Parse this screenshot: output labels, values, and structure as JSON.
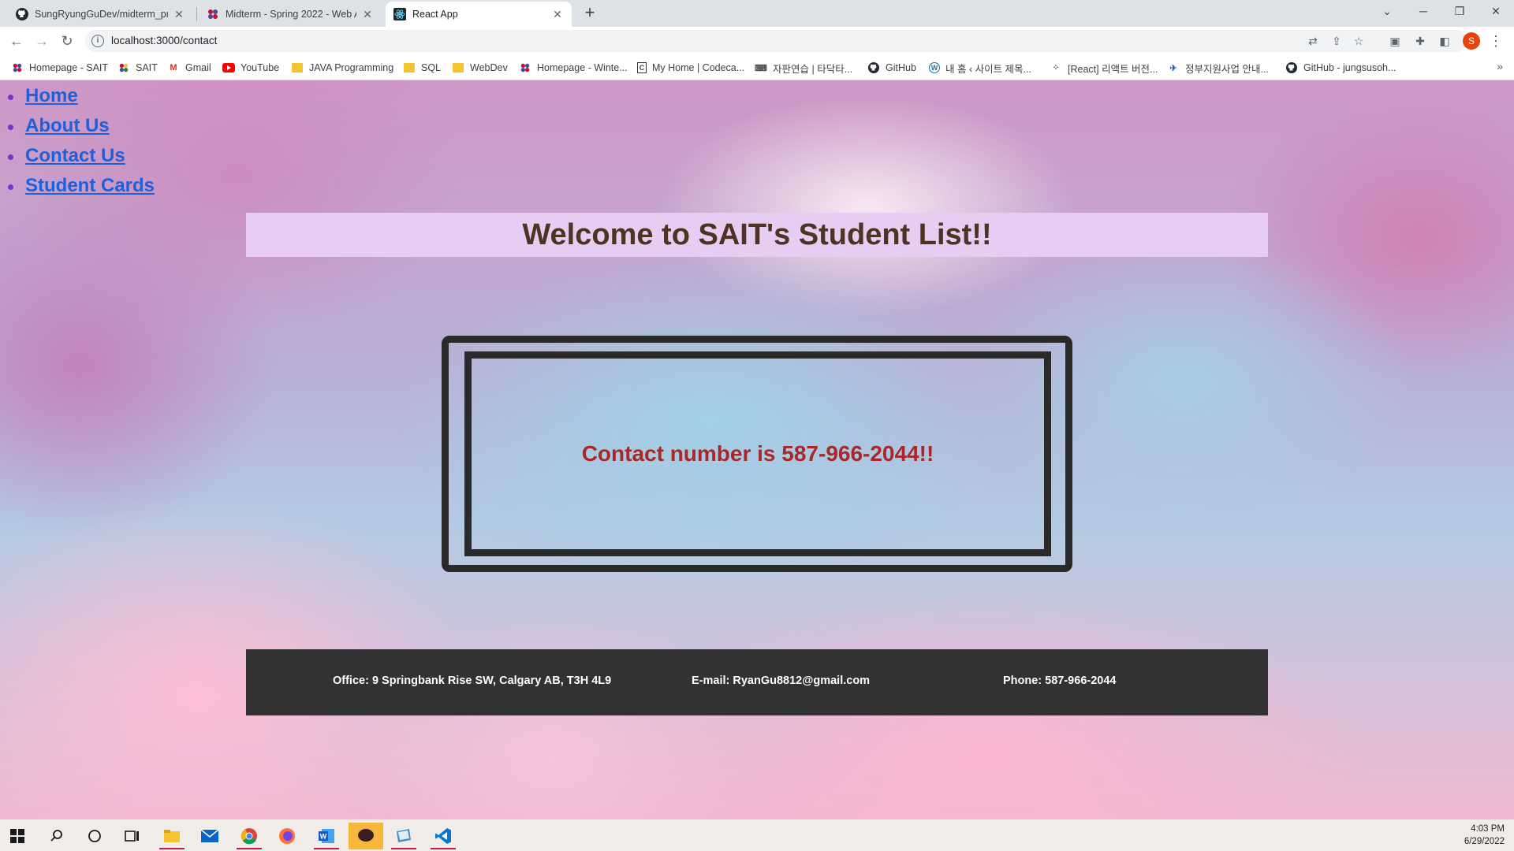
{
  "browser": {
    "tabs": [
      {
        "title": "SungRyungGuDev/midterm_proj",
        "icon": "github-icon"
      },
      {
        "title": "Midterm - Spring 2022 - Web Ap",
        "icon": "sait-icon"
      },
      {
        "title": "React App",
        "icon": "react-icon"
      }
    ],
    "new_tab": "+",
    "address": "localhost:3000/contact",
    "profile_initial": "S"
  },
  "bookmarks": [
    {
      "label": "Homepage - SAIT",
      "icon": "sait-icon"
    },
    {
      "label": "SAIT",
      "icon": "sait-icon"
    },
    {
      "label": "Gmail",
      "icon": "gmail-icon"
    },
    {
      "label": "YouTube",
      "icon": "youtube-icon"
    },
    {
      "label": "JAVA Programming",
      "icon": "folder-icon"
    },
    {
      "label": "SQL",
      "icon": "folder-icon"
    },
    {
      "label": "WebDev",
      "icon": "folder-icon"
    },
    {
      "label": "Homepage - Winte...",
      "icon": "sait-icon"
    },
    {
      "label": "My Home | Codeca...",
      "icon": "codecademy-icon"
    },
    {
      "label": "자판연습 | 타닥타...",
      "icon": "keyboard-icon"
    },
    {
      "label": "GitHub",
      "icon": "github-icon"
    },
    {
      "label": "내 홈 ‹ 사이트 제목...",
      "icon": "wordpress-icon"
    },
    {
      "label": "[React] 리액트 버전...",
      "icon": "dots-icon"
    },
    {
      "label": "정부지원사업 안내...",
      "icon": "gov-icon"
    },
    {
      "label": "GitHub - jungsusoh...",
      "icon": "github-icon"
    }
  ],
  "page": {
    "nav": [
      "Home",
      "About Us",
      "Contact Us",
      "Student Cards"
    ],
    "title": "Welcome to SAIT's Student List!!",
    "contact": "Contact number is 587-966-2044!!",
    "footer": {
      "office": "Office: 9 Springbank Rise SW, Calgary AB, T3H 4L9",
      "email": "E-mail: RyanGu8812@gmail.com",
      "phone": "Phone: 587-966-2044"
    }
  },
  "taskbar": {
    "time": "4:03 PM",
    "date": "6/29/2022"
  },
  "colors": {
    "nav_link": "#1f5fd8",
    "banner_bg": "#e6cdf1",
    "title_text": "#4e3322",
    "contact_text": "#a8282a",
    "footer_bg": "#323232"
  }
}
